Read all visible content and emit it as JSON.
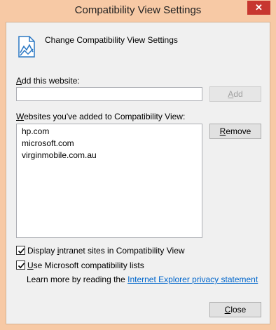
{
  "window": {
    "title": "Compatibility View Settings",
    "close_glyph": "✕"
  },
  "header": {
    "icon": "compatibility-view-icon",
    "text": "Change Compatibility View Settings"
  },
  "add_section": {
    "label": "Add this website:",
    "input_value": "",
    "add_button": "Add",
    "add_button_enabled": false
  },
  "list_section": {
    "label": "Websites you've added to Compatibility View:",
    "items": [
      "hp.com",
      "microsoft.com",
      "virginmobile.com.au"
    ],
    "remove_button": "Remove"
  },
  "options": {
    "intranet": {
      "label": "Display intranet sites in Compatibility View",
      "checked": true
    },
    "ms_lists": {
      "label": "Use Microsoft compatibility lists",
      "checked": true
    }
  },
  "learn_more": {
    "prefix": "Learn more by reading the",
    "link_text": "Internet Explorer privacy statement"
  },
  "footer": {
    "close_button": "Close"
  },
  "colors": {
    "titlebar": "#f7c9a5",
    "close": "#c7372f",
    "link": "#0066cc"
  }
}
